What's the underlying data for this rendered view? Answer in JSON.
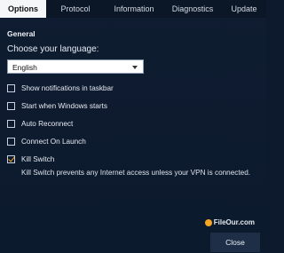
{
  "tabs": [
    {
      "label": "Options",
      "active": true
    },
    {
      "label": "Protocol",
      "active": false
    },
    {
      "label": "Information",
      "active": false
    },
    {
      "label": "Diagnostics",
      "active": false
    },
    {
      "label": "Update",
      "active": false
    }
  ],
  "general": {
    "title": "General",
    "language_label": "Choose your language:",
    "language_value": "English"
  },
  "options": [
    {
      "label": "Show notifications in taskbar",
      "checked": false
    },
    {
      "label": "Start when Windows starts",
      "checked": false
    },
    {
      "label": "Auto Reconnect",
      "checked": false
    },
    {
      "label": "Connect On Launch",
      "checked": false
    },
    {
      "label": "Kill Switch",
      "checked": true
    }
  ],
  "kill_switch_description": "Kill Switch prevents any Internet access unless your VPN is connected.",
  "watermark": "FileOur.com",
  "close_label": "Close",
  "colors": {
    "background": "#0d1a2e",
    "accent": "#f5a623",
    "active_tab": "#f5f6f8"
  }
}
